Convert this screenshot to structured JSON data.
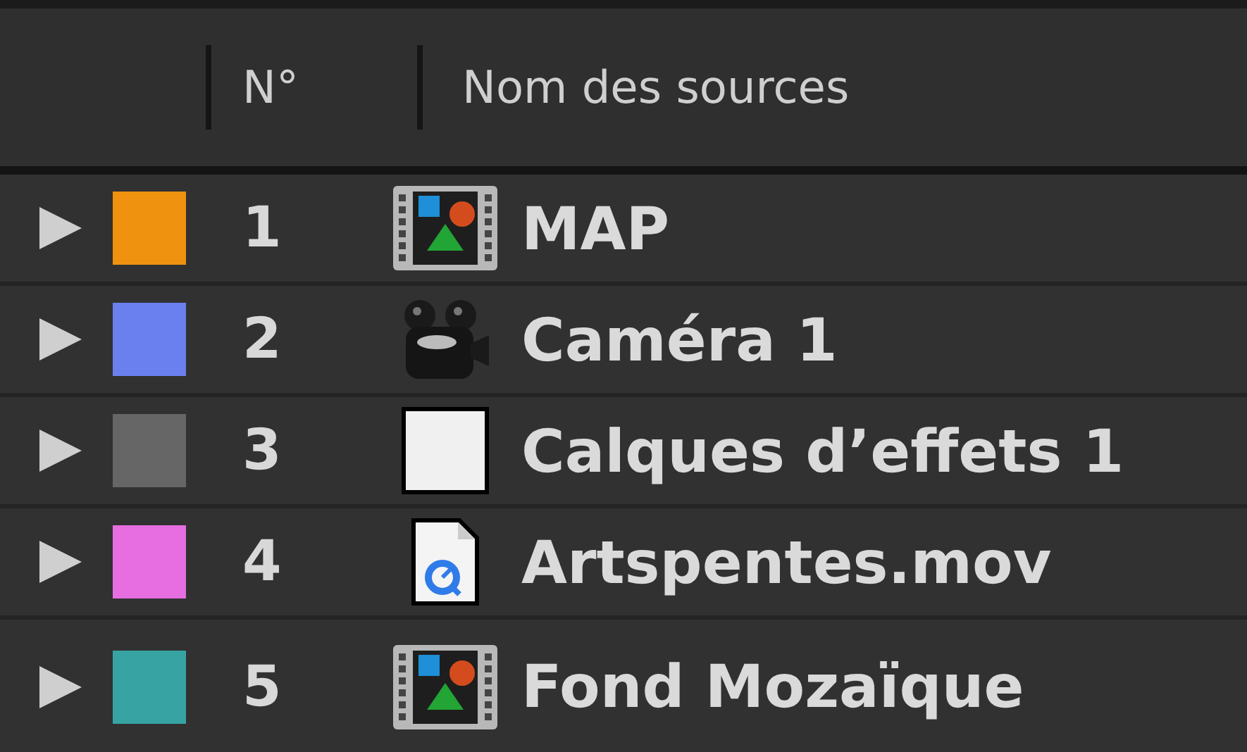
{
  "columns": [
    "N°",
    "Nom des sources"
  ],
  "layers": [
    {
      "number": "1",
      "name": "MAP",
      "color": "#ee9210",
      "kind": "composition",
      "expanded": false
    },
    {
      "number": "2",
      "name": "Caméra 1",
      "color": "#6a80ee",
      "kind": "camera",
      "expanded": false
    },
    {
      "number": "3",
      "name": "Calques d’effets 1",
      "color": "#666666",
      "kind": "solid",
      "expanded": false
    },
    {
      "number": "4",
      "name": "Artspentes.mov",
      "color": "#e66ee0",
      "kind": "movie",
      "expanded": false
    },
    {
      "number": "5",
      "name": "Fond Mozaïque",
      "color": "#38a3a3",
      "kind": "composition",
      "expanded": false
    }
  ]
}
